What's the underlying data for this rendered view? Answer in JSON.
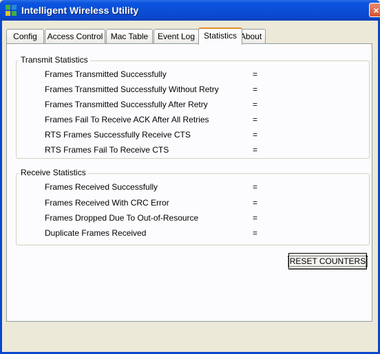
{
  "window": {
    "title": "Intelligent Wireless Utility",
    "close_label": "×"
  },
  "tabs": [
    {
      "label": "Config"
    },
    {
      "label": "Access Control"
    },
    {
      "label": "Mac Table"
    },
    {
      "label": "Event Log"
    },
    {
      "label": "Statistics",
      "active": true
    },
    {
      "label": "About"
    }
  ],
  "transmit": {
    "title": "Transmit Statistics",
    "rows": [
      {
        "label": "Frames Transmitted Successfully",
        "value": "="
      },
      {
        "label": "Frames Transmitted Successfully  Without Retry",
        "value": "="
      },
      {
        "label": "Frames Transmitted Successfully After Retry",
        "value": "="
      },
      {
        "label": "Frames Fail To Receive ACK After All Retries",
        "value": "="
      },
      {
        "label": "RTS Frames Successfully Receive CTS",
        "value": "="
      },
      {
        "label": "RTS Frames Fail To Receive CTS",
        "value": "="
      }
    ]
  },
  "receive": {
    "title": "Receive Statistics",
    "rows": [
      {
        "label": "Frames Received Successfully",
        "value": "="
      },
      {
        "label": "Frames Received With CRC Error",
        "value": "="
      },
      {
        "label": "Frames Dropped Due To Out-of-Resource",
        "value": "="
      },
      {
        "label": "Duplicate Frames Received",
        "value": "="
      }
    ]
  },
  "actions": {
    "reset_label": "RESET COUNTERS"
  },
  "colors": {
    "titlebar": "#0a54e0",
    "close": "#d5532f",
    "tab_highlight": "#e68b2c",
    "face": "#ece9d8"
  }
}
